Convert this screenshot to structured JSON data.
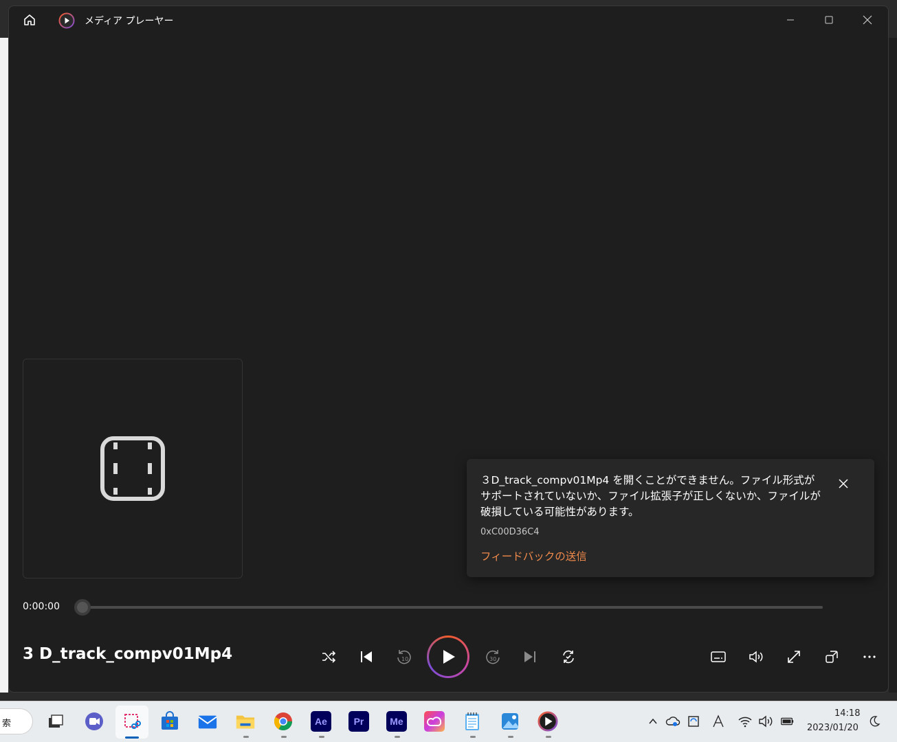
{
  "app": {
    "title": "メディア プレーヤー"
  },
  "window_controls": [
    "minimize",
    "maximize",
    "close"
  ],
  "error": {
    "message": "３D_track_compv01Mp4 を開くことができません。ファイル形式がサポートされていないか、ファイル拡張子が正しくないか、ファイルが破損している可能性があります。",
    "code": "0xC00D36C4",
    "feedback_link": "フィードバックの送信"
  },
  "player": {
    "current_time": "0:00:00",
    "progress": 0,
    "track_title": "3 D_track_compv01Mp4",
    "controls": [
      "shuffle",
      "previous",
      "skip-back-10",
      "play",
      "skip-forward-30",
      "next",
      "repeat"
    ],
    "right_controls": [
      "captions",
      "volume",
      "fullscreen",
      "mini-player",
      "more"
    ]
  },
  "taskbar": {
    "search_text": "索",
    "apps": [
      "file-explorer-task-view",
      "teams",
      "snipping-tool",
      "microsoft-store",
      "mail",
      "file-explorer",
      "chrome",
      "after-effects",
      "premiere-pro",
      "media-encoder",
      "creative-cloud",
      "notepad",
      "photos",
      "media-player"
    ],
    "app_labels": {
      "ae": "Ae",
      "pr": "Pr",
      "me": "Me"
    },
    "clock": {
      "time": "14:18",
      "date": "2023/01/20"
    }
  },
  "colors": {
    "window_bg": "#1e1e1e",
    "accent_link": "#f08a4b",
    "play_ring_start": "#f25c2a",
    "play_ring_end": "#7b4dd6"
  }
}
